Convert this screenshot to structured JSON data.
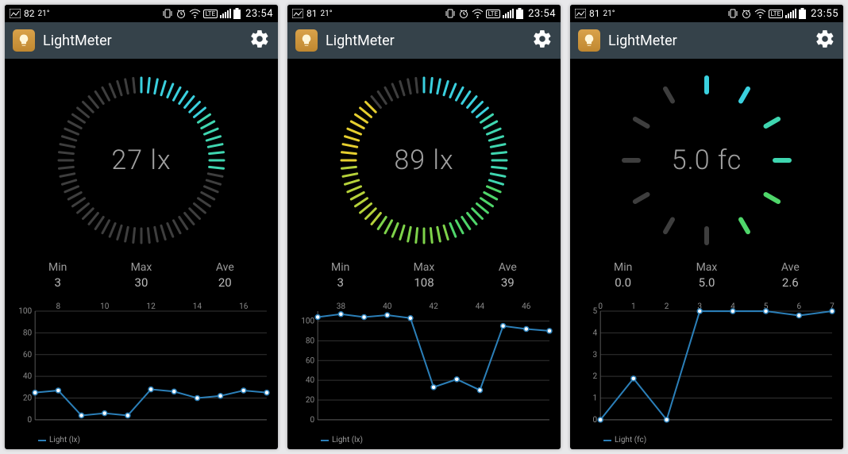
{
  "screens": [
    {
      "status": {
        "left1": "82",
        "left2": "21°",
        "clock": "23:54",
        "lte": "LTE"
      },
      "app_title": "LightMeter",
      "gauge": {
        "value": "27 lx",
        "fill_fraction": 0.27,
        "start_angle": -90,
        "tick_mode": "dense"
      },
      "stats": {
        "min_label": "Min",
        "max_label": "Max",
        "ave_label": "Ave",
        "min": "3",
        "max": "30",
        "ave": "20"
      },
      "chart_data": {
        "type": "line",
        "x": [
          7,
          8,
          9,
          10,
          11,
          12,
          13,
          14,
          15,
          16,
          17
        ],
        "values": [
          25,
          27,
          4,
          6,
          4,
          28,
          26,
          20,
          22,
          27,
          25
        ],
        "xlabel": "",
        "ylabel": "",
        "x_ticks": [
          8,
          10,
          12,
          14,
          16
        ],
        "y_ticks": [
          0,
          20,
          40,
          60,
          80,
          100
        ],
        "xlim": [
          7,
          17
        ],
        "ylim": [
          0,
          100
        ],
        "legend": "Light (lx)"
      }
    },
    {
      "status": {
        "left1": "81",
        "left2": "21°",
        "clock": "23:54",
        "lte": "LTE"
      },
      "app_title": "LightMeter",
      "gauge": {
        "value": "89 lx",
        "fill_fraction": 0.89,
        "start_angle": -90,
        "tick_mode": "dense"
      },
      "stats": {
        "min_label": "Min",
        "max_label": "Max",
        "ave_label": "Ave",
        "min": "3",
        "max": "108",
        "ave": "39"
      },
      "chart_data": {
        "type": "line",
        "x": [
          37,
          38,
          39,
          40,
          41,
          42,
          43,
          44,
          45,
          46,
          47
        ],
        "values": [
          104,
          107,
          104,
          106,
          103,
          33,
          41,
          30,
          95,
          92,
          90
        ],
        "xlabel": "",
        "ylabel": "",
        "x_ticks": [
          38,
          40,
          42,
          44,
          46
        ],
        "y_ticks": [
          0,
          20,
          40,
          60,
          80,
          100
        ],
        "xlim": [
          37,
          47
        ],
        "ylim": [
          0,
          110
        ],
        "legend": "Light (lx)"
      }
    },
    {
      "status": {
        "left1": "81",
        "left2": "21°",
        "clock": "23:55",
        "lte": "LTE"
      },
      "app_title": "LightMeter",
      "gauge": {
        "value": "5.0 fc",
        "fill_fraction": 0.5,
        "start_angle": -90,
        "tick_mode": "sparse"
      },
      "stats": {
        "min_label": "Min",
        "max_label": "Max",
        "ave_label": "Ave",
        "min": "0.0",
        "max": "5.0",
        "ave": "2.6"
      },
      "chart_data": {
        "type": "line",
        "x": [
          0,
          1,
          2,
          3,
          4,
          5,
          6,
          7
        ],
        "values": [
          0.0,
          1.9,
          0.0,
          5.0,
          5.0,
          5.0,
          4.8,
          5.0
        ],
        "xlabel": "",
        "ylabel": "",
        "x_ticks": [
          0,
          1,
          2,
          3,
          4,
          5,
          6,
          7
        ],
        "y_ticks": [
          0,
          1,
          2,
          3,
          4,
          5
        ],
        "xlim": [
          0,
          7
        ],
        "ylim": [
          0,
          5
        ],
        "legend": "Light (fc)"
      }
    }
  ]
}
